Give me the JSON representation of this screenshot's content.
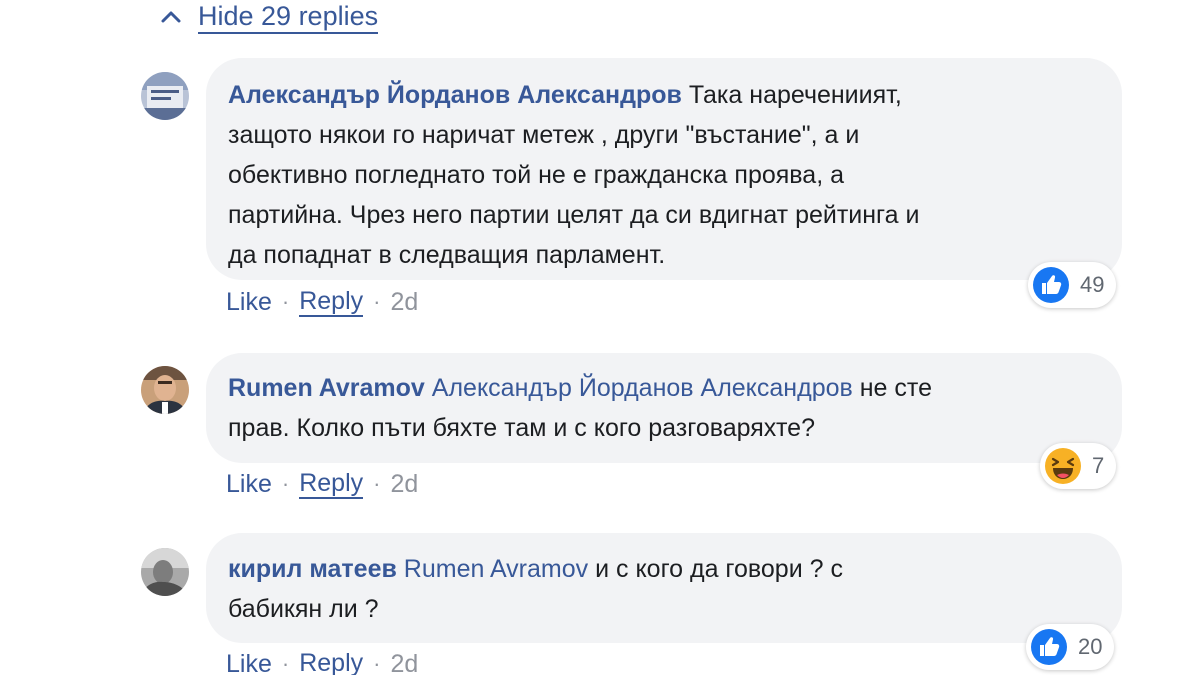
{
  "thread": {
    "hide_replies_label": "Hide 29 replies"
  },
  "comments": [
    {
      "author": "Александър Йорданов Александров",
      "mention": "",
      "text_lines": [
        "Така наречениият,",
        "защото някои го наричат метеж , други \"въстание\", а и",
        "обективно погледнато той не е гражданска проява, а",
        "партийна. Чрез него партии целят да си вдигнат рейтинга и",
        "да попаднат в следващия парламент."
      ],
      "like_label": "Like",
      "reply_label": "Reply",
      "separator": "·",
      "time": "2d",
      "reaction_icon": "like-icon",
      "reaction_count": "49"
    },
    {
      "author": "Rumen Avramov",
      "mention": "Александър Йорданов Александров",
      "text_lines": [
        "не сте",
        "прав. Колко пъти бяхте там и с кого разговаряхте?"
      ],
      "like_label": "Like",
      "reply_label": "Reply",
      "separator": "·",
      "time": "2d",
      "reaction_icon": "haha-icon",
      "reaction_count": "7"
    },
    {
      "author": "кирил матеев",
      "mention": "Rumen Avramov",
      "text_lines": [
        "и с кого да говори ? с",
        "бабикян ли ?"
      ],
      "like_label": "Like",
      "reply_label": "Reply",
      "separator": "·",
      "time": "2d",
      "reaction_icon": "like-icon",
      "reaction_count": "20"
    }
  ],
  "colors": {
    "link": "#385898",
    "bubble_bg": "#f2f3f5",
    "like_blue": "#1877f2",
    "haha_yellow": "#f7b125",
    "meta_gray": "#90949c"
  }
}
